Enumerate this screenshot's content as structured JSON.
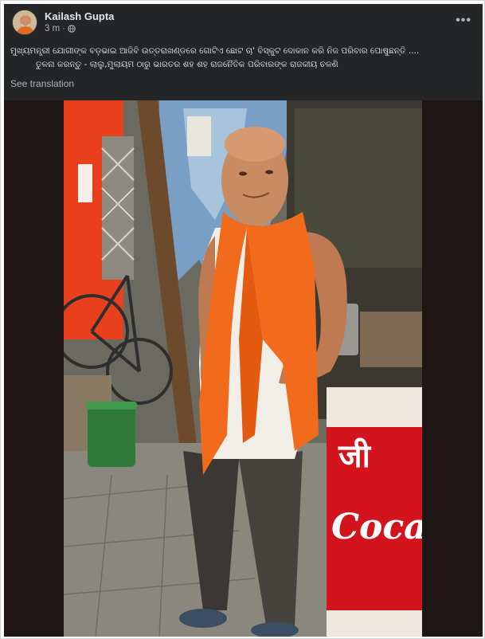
{
  "post": {
    "author": "Kailash Gupta",
    "time": "3 m",
    "separator": "·",
    "visibility_icon": "globe-icon",
    "more_icon": "more-options-icon",
    "more_label": "•••",
    "text_line_1": "ମୁଖ୍ୟମନ୍ତ୍ରୀ ଯୋଗୀଙ୍କ ବଡ଼ଭାଇ ଆଜିବି ଉତ୍ତରାଖଣ୍ଡରେ ଗୋଟିଏ ଛୋଟ ଚା' ବିସ୍କୁଟ ଦୋକାନ କରି ନିଜ ପରିବାର ପୋଷୁଛନ୍ତି ....",
    "text_line_2": "ତୁଳନା କରନ୍ତୁ - ଲାଲୁ,ମୁଲାୟମ ଠାରୁ ଭାରତର ଶହ ଶହ ରାଜନୈତିକ ପରିବାରଙ୍କ ରାଜକୀୟ ଚଳଣି",
    "see_translation": "See translation"
  },
  "photo": {
    "sign_text_1": "जी",
    "sign_text_2": "Coca",
    "colors": {
      "card_bg": "#242526",
      "scarf": "#f26a1b",
      "wall_red": "#e8401c",
      "cocacola_red": "#d4141c"
    }
  }
}
